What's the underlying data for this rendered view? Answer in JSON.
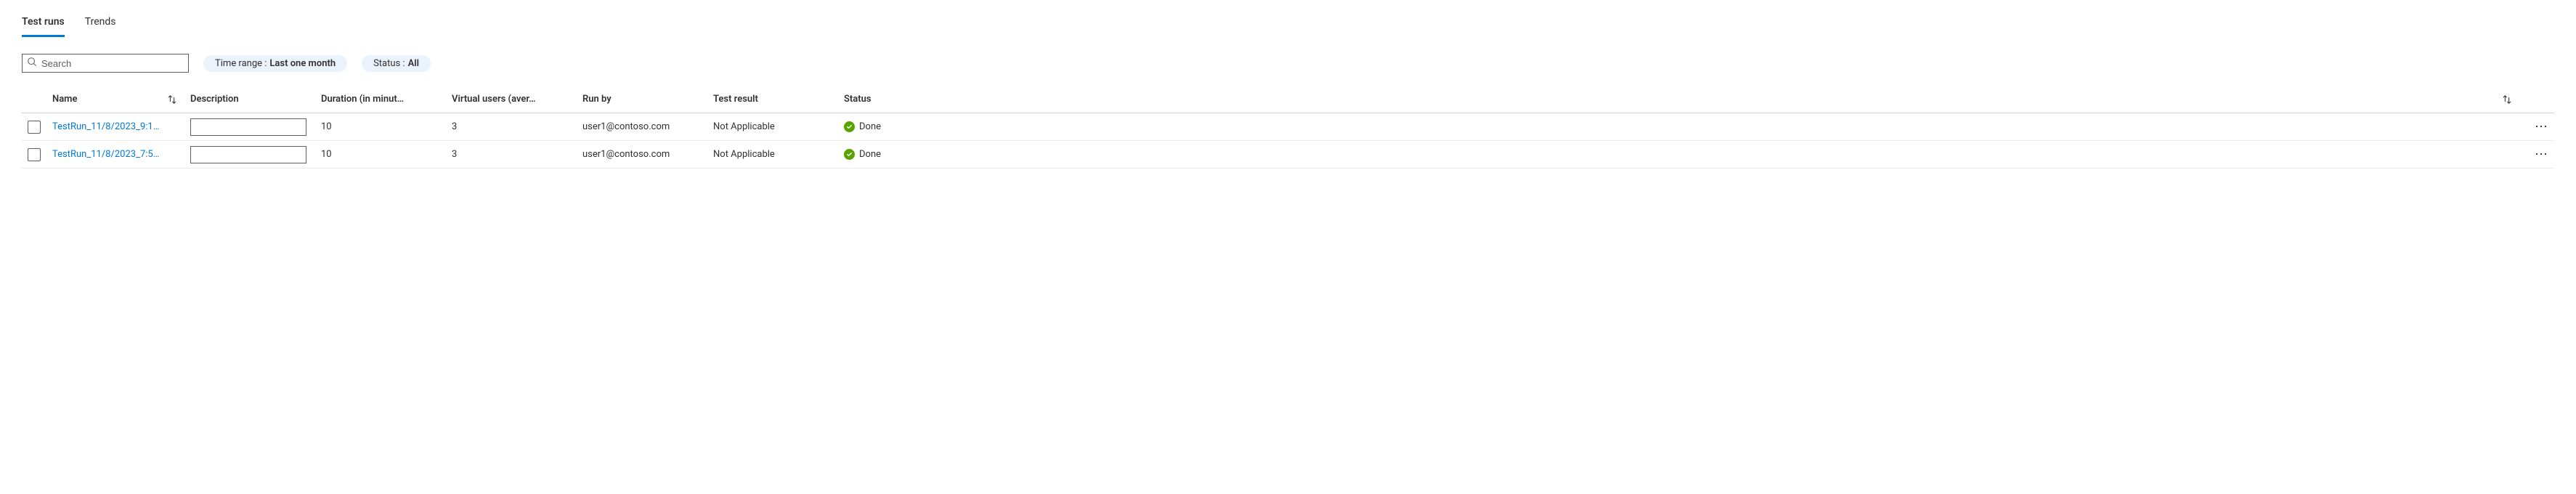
{
  "tabs": {
    "test_runs": "Test runs",
    "trends": "Trends"
  },
  "filters": {
    "search_placeholder": "Search",
    "time_range_label": "Time range :",
    "time_range_value": "Last one month",
    "status_label": "Status :",
    "status_value": "All"
  },
  "columns": {
    "name": "Name",
    "description": "Description",
    "duration": "Duration (in minut…",
    "virtual_users": "Virtual users (aver…",
    "run_by": "Run by",
    "test_result": "Test result",
    "status": "Status"
  },
  "rows": [
    {
      "name": "TestRun_11/8/2023_9:1…",
      "description": "",
      "duration": "10",
      "virtual_users": "3",
      "run_by": "user1@contoso.com",
      "test_result": "Not Applicable",
      "status": "Done"
    },
    {
      "name": "TestRun_11/8/2023_7:5…",
      "description": "",
      "duration": "10",
      "virtual_users": "3",
      "run_by": "user1@contoso.com",
      "test_result": "Not Applicable",
      "status": "Done"
    }
  ]
}
